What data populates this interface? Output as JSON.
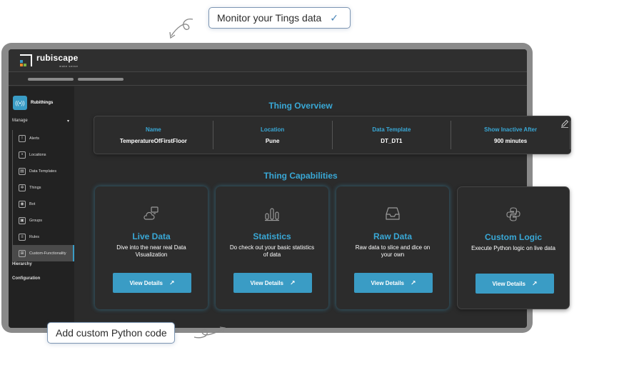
{
  "callouts": {
    "top": "Monitor your Tings data",
    "bottom": "Add custom Python code"
  },
  "brand": {
    "name": "rubiscape",
    "tagline": "make sense"
  },
  "sidebar": {
    "app_name": "Rubithings",
    "manage_label": "Manage",
    "items": [
      {
        "label": "Alerts",
        "icon": "alert-icon"
      },
      {
        "label": "Locations",
        "icon": "location-icon"
      },
      {
        "label": "Data  Templates",
        "icon": "template-icon"
      },
      {
        "label": "Things",
        "icon": "thing-icon"
      },
      {
        "label": "Bot",
        "icon": "bot-icon"
      },
      {
        "label": "Groups",
        "icon": "groups-icon"
      },
      {
        "label": "Rules",
        "icon": "rules-icon"
      },
      {
        "label": "Custom-Functionality",
        "icon": "custom-icon"
      }
    ],
    "hierarchy_label": "Hierarchy",
    "configuration_label": "Configuration"
  },
  "overview": {
    "title": "Thing Overview",
    "columns": [
      {
        "label": "Name",
        "value": "TemperatureOfFirstFloor"
      },
      {
        "label": "Location",
        "value": "Pune"
      },
      {
        "label": "Data Template",
        "value": "DT_DT1"
      },
      {
        "label": "Show Inactive After",
        "value": "900 minutes"
      }
    ]
  },
  "capabilities": {
    "title": "Thing Capabilities",
    "button_label": "View Details",
    "cards": [
      {
        "title": "Live Data",
        "desc": "Dive into the near real Data Visualization",
        "icon": "cloud-monitor-icon"
      },
      {
        "title": "Statistics",
        "desc": "Do check out your basic statistics of data",
        "icon": "bar-stats-icon"
      },
      {
        "title": "Raw Data",
        "desc": "Raw data to slice and dice on your own",
        "icon": "inbox-tray-icon"
      },
      {
        "title": "Custom Logic",
        "desc": "Execute Python logic on live data",
        "icon": "python-icon"
      }
    ]
  },
  "colors": {
    "accent": "#3a9cc5",
    "heading": "#39a8d6",
    "background": "#2b2b2b"
  }
}
